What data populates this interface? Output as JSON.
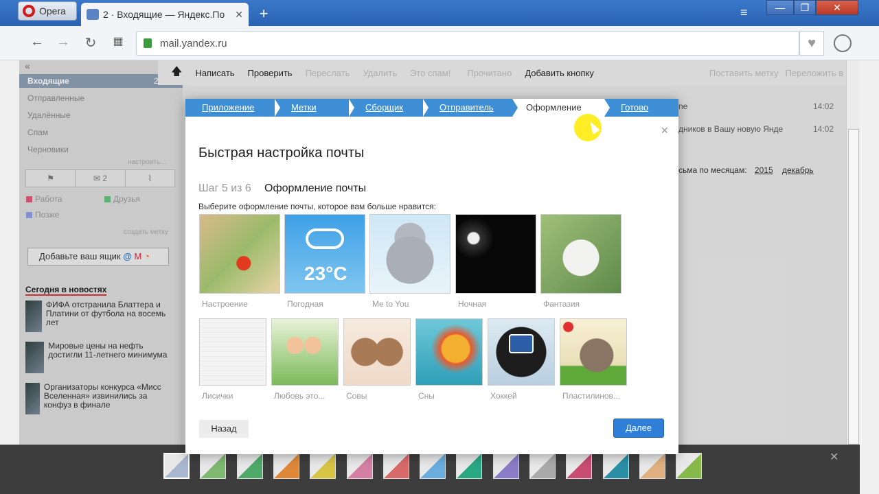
{
  "browser": {
    "menu_label": "Opera",
    "tab_title": "2 · Входящие — Яндекс.По",
    "url": "mail.yandex.ru"
  },
  "sidebar": {
    "inbox": "Входящие",
    "inbox_count": "2",
    "items": [
      "Отправленные",
      "Удалённые",
      "Спам",
      "Черновики"
    ],
    "settings_link": "настроить...",
    "filter_count": "2",
    "labels": [
      {
        "name": "Работа",
        "color": "#e05a77"
      },
      {
        "name": "Друзья",
        "color": "#66c07a"
      },
      {
        "name": "Позже",
        "color": "#8f9de0"
      }
    ],
    "create_label": "создать метку",
    "add_mailbox": "Добавьте ваш ящик",
    "news_heading": "Сегодня в новостях",
    "news": [
      {
        "text": "ФИФА отстранила Блаттера и Платини от футбола на восемь лет"
      },
      {
        "text": "Мировые цены на нефть достигли 11-летнего минимума"
      },
      {
        "text": "Организаторы конкурса «Мисс Вселенная» извинились за конфуз в финале"
      }
    ]
  },
  "toolbar": {
    "compose": "Написать",
    "check": "Проверить",
    "forward": "Переслать",
    "delete": "Удалить",
    "spam": "Это спам!",
    "read": "Прочитано",
    "add_button": "Добавить кнопку",
    "set_label": "Поставить метку",
    "move_folder": "Переложить в папку"
  },
  "mail_list": {
    "time1": "14:02",
    "time2": "14:02",
    "snippet1": "ne",
    "snippet2": "дников в Вашу новую Янде",
    "archive_prefix": "сьма по месяцам:",
    "year": "2015",
    "month": "декабрь"
  },
  "wizard": {
    "steps": [
      "Приложение",
      "Метки",
      "Сборщик",
      "Отправитель",
      "Оформление",
      "Готово"
    ],
    "active_step": 4,
    "title": "Быстрая настройка почты",
    "step_counter": "Шаг 5 из 6",
    "step_name": "Оформление почты",
    "description": "Выберите оформление почты, которое вам больше нравится:",
    "themes_row1": [
      "Настроение",
      "Погодная",
      "Me to You",
      "Ночная",
      "Фантазия"
    ],
    "themes_row2": [
      "Лисички",
      "Любовь это...",
      "Совы",
      "Сны",
      "Хоккей",
      "Пластилинов..."
    ],
    "weather_temp": "23°C",
    "back": "Назад",
    "next": "Далее"
  },
  "swatches": [
    "#a9b6cf",
    "#7fb870",
    "#4faa6a",
    "#e0883a",
    "#d8c544",
    "#d57fa5",
    "#d96a6a",
    "#6aaee0",
    "#2aa884",
    "#8a7cc7",
    "#aaaaaa",
    "#c94d72",
    "#2a8fa5",
    "#e0b080",
    "#86b84a"
  ]
}
